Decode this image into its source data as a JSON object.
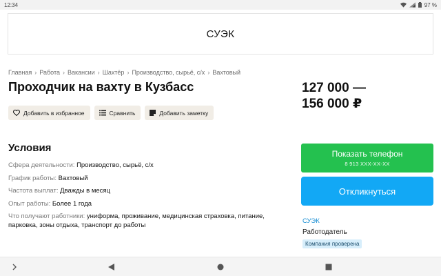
{
  "status_bar": {
    "time": "12:34",
    "battery": "97 %",
    "icons": [
      "wifi-icon",
      "signal-icon",
      "battery-icon"
    ]
  },
  "company_logo_text": "СУЭК",
  "breadcrumb": [
    "Главная",
    "Работа",
    "Вакансии",
    "Шахтёр",
    "Производство, сырьё, с/х",
    "Вахтовый"
  ],
  "vacancy": {
    "title": "Проходчик на вахту в Кузбасс",
    "salary_line1": "127 000 —",
    "salary_line2": "156 000 ₽"
  },
  "actions": {
    "favorite": "Добавить в избранное",
    "compare": "Сравнить",
    "note": "Добавить заметку"
  },
  "conditions": {
    "heading": "Условия",
    "items": [
      {
        "label": "Сфера деятельности:",
        "value": "Производство, сырьё, с/х"
      },
      {
        "label": "График работы:",
        "value": "Вахтовый"
      },
      {
        "label": "Частота выплат:",
        "value": "Дважды в месяц"
      },
      {
        "label": "Опыт работы:",
        "value": "Более 1 года"
      },
      {
        "label": "Что получают работники:",
        "value": "униформа, проживание, медицинская страховка, питание, парковка, зоны отдыха, транспорт до работы"
      }
    ]
  },
  "contact": {
    "phone_button": "Показать телефон",
    "phone_masked": "8 913 XXX-XX-XX",
    "respond_button": "Откликнуться"
  },
  "employer": {
    "name": "СУЭК",
    "role": "Работодатель",
    "badge": "Компания проверена"
  },
  "colors": {
    "phone_button": "#24c14f",
    "respond_button": "#12a8f5",
    "employer_link": "#1a8fd4",
    "chip_bg": "#f1ede6",
    "badge_bg": "#d7eefb"
  },
  "nav_bar": {
    "icons": [
      "chevron-right-icon",
      "back-icon",
      "home-icon",
      "recents-icon"
    ]
  }
}
